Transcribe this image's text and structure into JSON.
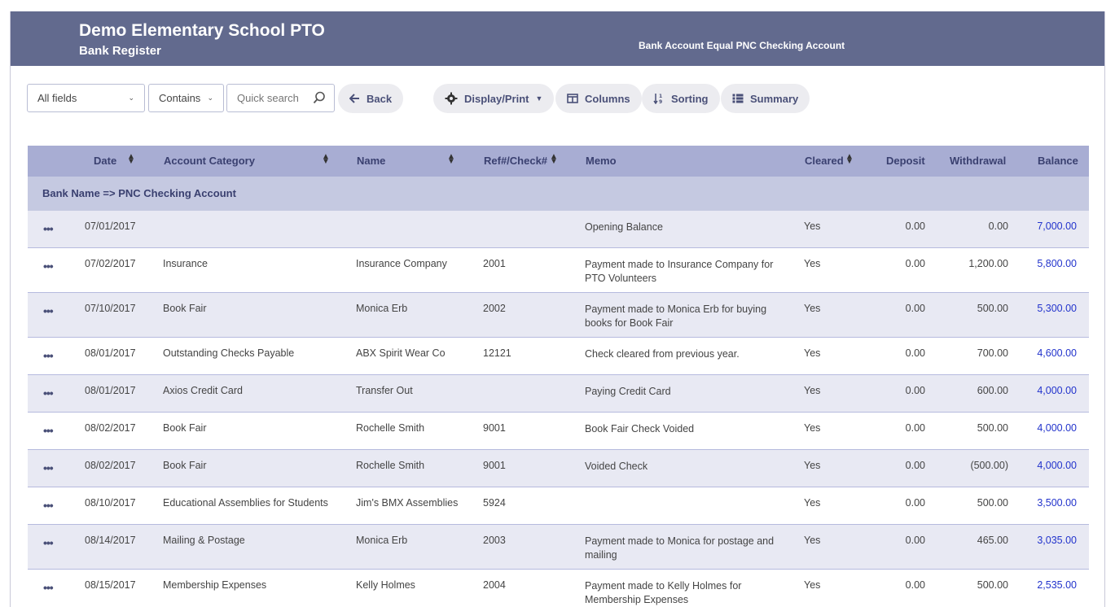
{
  "header": {
    "title": "Demo Elementary School PTO",
    "subtitle": "Bank Register",
    "filter": "Bank Account Equal PNC Checking Account",
    "bg_color": "#626a8e"
  },
  "toolbar": {
    "field_select": "All fields",
    "operator_select": "Contains",
    "search_placeholder": "Quick search",
    "back_label": "Back",
    "display_label": "Display/Print",
    "columns_label": "Columns",
    "sorting_label": "Sorting",
    "summary_label": "Summary"
  },
  "table": {
    "headers": {
      "date": "Date",
      "category": "Account Category",
      "name": "Name",
      "ref": "Ref#/Check#",
      "memo": "Memo",
      "cleared": "Cleared",
      "deposit": "Deposit",
      "withdrawal": "Withdrawal",
      "balance": "Balance"
    },
    "group_label": "Bank Name => PNC Checking Account",
    "rows": [
      {
        "date": "07/01/2017",
        "category": "",
        "name": "",
        "ref": "",
        "memo": "Opening Balance",
        "cleared": "Yes",
        "deposit": "0.00",
        "withdrawal": "0.00",
        "balance": "7,000.00"
      },
      {
        "date": "07/02/2017",
        "category": "Insurance",
        "name": "Insurance Company",
        "ref": "2001",
        "memo": "Payment made to Insurance Company for PTO Volunteers",
        "cleared": "Yes",
        "deposit": "0.00",
        "withdrawal": "1,200.00",
        "balance": "5,800.00"
      },
      {
        "date": "07/10/2017",
        "category": "Book Fair",
        "name": "Monica Erb",
        "ref": "2002",
        "memo": "Payment made to Monica Erb for buying books for Book Fair",
        "cleared": "Yes",
        "deposit": "0.00",
        "withdrawal": "500.00",
        "balance": "5,300.00"
      },
      {
        "date": "08/01/2017",
        "category": "Outstanding Checks Payable",
        "name": "ABX Spirit Wear Co",
        "ref": "12121",
        "memo": "Check cleared from previous year.",
        "cleared": "Yes",
        "deposit": "0.00",
        "withdrawal": "700.00",
        "balance": "4,600.00"
      },
      {
        "date": "08/01/2017",
        "category": "Axios Credit Card",
        "name": "Transfer Out",
        "ref": "",
        "memo": "Paying Credit Card",
        "cleared": "Yes",
        "deposit": "0.00",
        "withdrawal": "600.00",
        "balance": "4,000.00"
      },
      {
        "date": "08/02/2017",
        "category": "Book Fair",
        "name": "Rochelle Smith",
        "ref": "9001",
        "memo": "Book Fair Check Voided",
        "cleared": "Yes",
        "deposit": "0.00",
        "withdrawal": "500.00",
        "balance": "4,000.00"
      },
      {
        "date": "08/02/2017",
        "category": "Book Fair",
        "name": "Rochelle Smith",
        "ref": "9001",
        "memo": "Voided Check",
        "cleared": "Yes",
        "deposit": "0.00",
        "withdrawal": "(500.00)",
        "balance": "4,000.00"
      },
      {
        "date": "08/10/2017",
        "category": "Educational Assemblies for Students",
        "name": "Jim's BMX Assemblies",
        "ref": "5924",
        "memo": "",
        "cleared": "Yes",
        "deposit": "0.00",
        "withdrawal": "500.00",
        "balance": "3,500.00"
      },
      {
        "date": "08/14/2017",
        "category": "Mailing & Postage",
        "name": "Monica Erb",
        "ref": "2003",
        "memo": "Payment made to Monica for postage and mailing",
        "cleared": "Yes",
        "deposit": "0.00",
        "withdrawal": "465.00",
        "balance": "3,035.00"
      },
      {
        "date": "08/15/2017",
        "category": "Membership Expenses",
        "name": "Kelly Holmes",
        "ref": "2004",
        "memo": "Payment made to Kelly Holmes for Membership Expenses",
        "cleared": "Yes",
        "deposit": "0.00",
        "withdrawal": "500.00",
        "balance": "2,535.00"
      }
    ]
  }
}
